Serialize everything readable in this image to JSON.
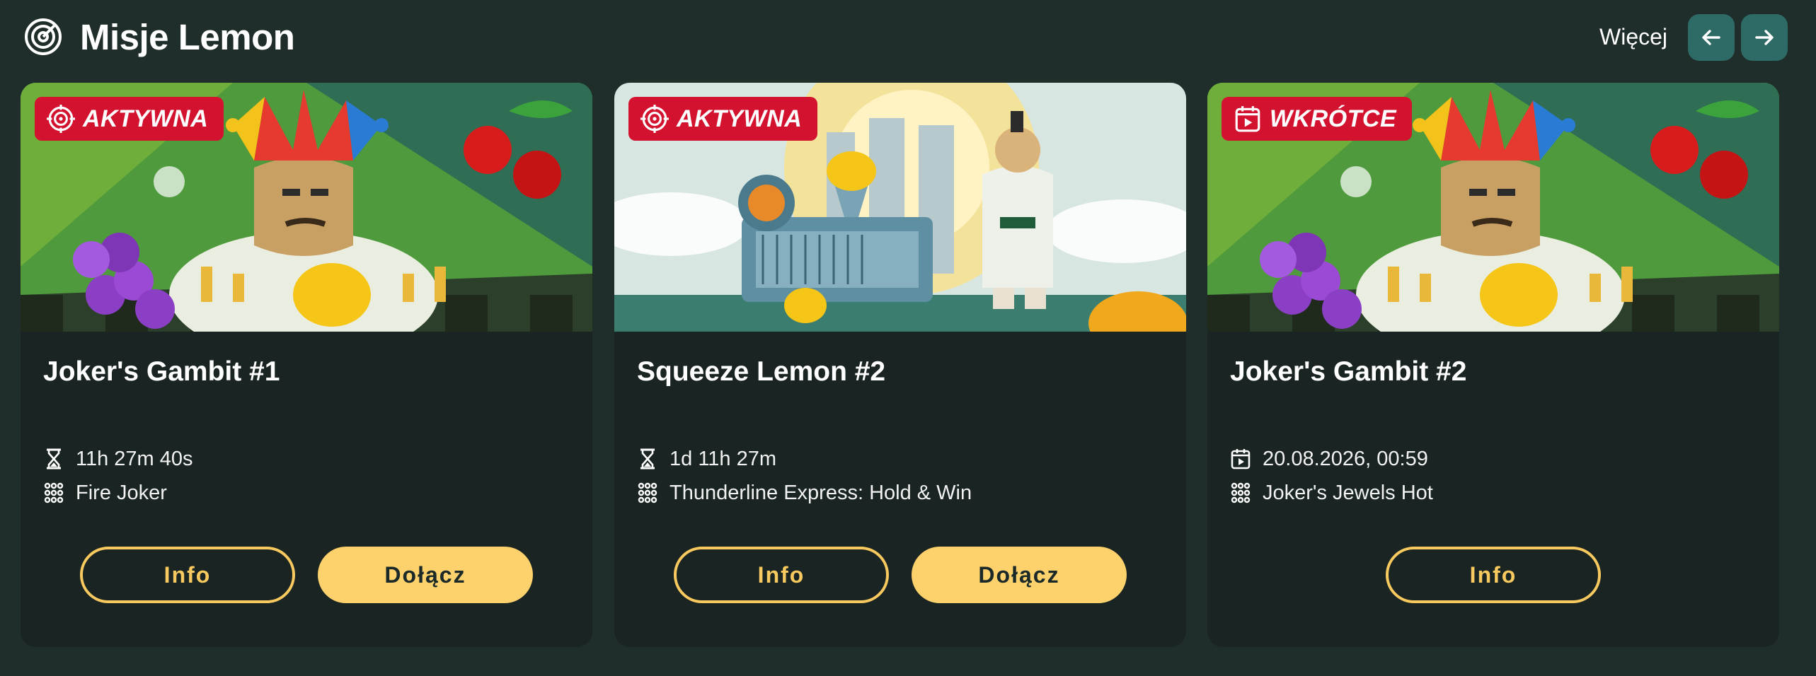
{
  "header": {
    "title": "Misje Lemon",
    "more_label": "Więcej",
    "icon": "target-icon",
    "prev_icon": "arrow-left-icon",
    "next_icon": "arrow-right-icon"
  },
  "colors": {
    "background": "#1f2d2b",
    "card": "#192423",
    "badge": "#d3122f",
    "accent": "#fdd16b",
    "nav_button": "#2e6b66"
  },
  "missions": [
    {
      "status": "AKTYWNA",
      "status_icon": "target-icon",
      "image": "joker-chess-fruit-banner",
      "title": "Joker's Gambit #1",
      "time_icon": "hourglass-icon",
      "time": "11h 27m 40s",
      "game_icon": "grid-dots-icon",
      "game": "Fire Joker",
      "info_label": "Info",
      "join_label": "Dołącz"
    },
    {
      "status": "AKTYWNA",
      "status_icon": "target-icon",
      "image": "lemon-squeezer-machine-banner",
      "title": "Squeeze Lemon #2",
      "time_icon": "hourglass-icon",
      "time": "1d 11h 27m",
      "game_icon": "grid-dots-icon",
      "game": "Thunderline Express: Hold & Win",
      "info_label": "Info",
      "join_label": "Dołącz"
    },
    {
      "status": "WKRÓTCE",
      "status_icon": "calendar-play-icon",
      "image": "joker-chess-fruit-banner",
      "title": "Joker's Gambit #2",
      "time_icon": "calendar-play-icon",
      "time": "20.08.2026, 00:59",
      "game_icon": "grid-dots-icon",
      "game": "Joker's Jewels Hot",
      "info_label": "Info"
    }
  ]
}
